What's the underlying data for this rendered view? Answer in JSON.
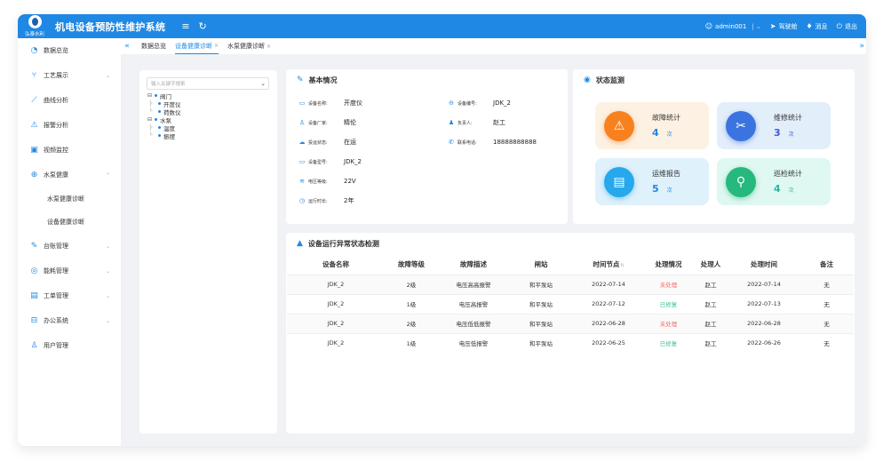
{
  "header": {
    "logo_text": "弘泰水利",
    "title": "机电设备预防性维护系统",
    "menu_icon": "hamburger-icon",
    "refresh_icon": "refresh-icon",
    "user": "admin001",
    "items": [
      {
        "label": "驾驶舱",
        "icon": "send-icon"
      },
      {
        "label": "消息",
        "icon": "bell-icon"
      },
      {
        "label": "退出",
        "icon": "power-icon"
      }
    ]
  },
  "sidebar": {
    "items": [
      {
        "label": "数据总览",
        "icon": "dashboard-icon",
        "has_children": false
      },
      {
        "label": "工艺展示",
        "icon": "process-icon",
        "has_children": true
      },
      {
        "label": "曲线分析",
        "icon": "curve-icon",
        "has_children": false
      },
      {
        "label": "报警分析",
        "icon": "alarm-icon",
        "has_children": false
      },
      {
        "label": "视频监控",
        "icon": "video-icon",
        "has_children": false
      },
      {
        "label": "水泵健康",
        "icon": "health-icon",
        "has_children": true,
        "expanded": true,
        "children": [
          "水泵健康诊断",
          "设备健康诊断"
        ]
      },
      {
        "label": "台账管理",
        "icon": "ledger-icon",
        "has_children": true
      },
      {
        "label": "能耗管理",
        "icon": "energy-icon",
        "has_children": true
      },
      {
        "label": "工单管理",
        "icon": "workorder-icon",
        "has_children": true
      },
      {
        "label": "办公系统",
        "icon": "office-icon",
        "has_children": true
      },
      {
        "label": "用户管理",
        "icon": "user-icon",
        "has_children": false
      }
    ]
  },
  "tabs": [
    {
      "label": "数据总览",
      "closable": false,
      "active": false
    },
    {
      "label": "设备健康诊断",
      "closable": true,
      "active": true
    },
    {
      "label": "水泵健康诊断",
      "closable": true,
      "active": false
    }
  ],
  "tree": {
    "placeholder": "输入关键字搜索",
    "nodes": [
      {
        "label": "阀门",
        "children": [
          "开度仪",
          "荷数仪"
        ]
      },
      {
        "label": "水泵",
        "children": [
          "温度",
          "振摆"
        ]
      }
    ]
  },
  "basic_info": {
    "title": "基本情况",
    "fields": [
      {
        "label": "设备名称:",
        "value": "开度仪",
        "icon": "device-icon"
      },
      {
        "label": "设备编号:",
        "value": "JDK_2",
        "icon": "id-icon"
      },
      {
        "label": "设备厂家:",
        "value": "精伦",
        "icon": "factory-icon"
      },
      {
        "label": "负责人:",
        "value": "赵工",
        "icon": "person-icon"
      },
      {
        "label": "投运状态:",
        "value": "在运",
        "icon": "cloud-icon"
      },
      {
        "label": "联系电话:",
        "value": "18888888888",
        "icon": "phone-icon"
      },
      {
        "label": "设备型号:",
        "value": "JDK_2",
        "icon": "monitor-icon"
      },
      {
        "label": "电压等级:",
        "value": "22V",
        "icon": "voltage-icon"
      },
      {
        "label": "运行时长:",
        "value": "2年",
        "icon": "clock-icon"
      }
    ]
  },
  "status": {
    "title": "状态监测",
    "cards": [
      {
        "name": "故障统计",
        "value": "4",
        "unit": "次",
        "icon": "warning-icon",
        "bg": "#fdf1e3",
        "circle": "#f7811f",
        "color": "#1f88e4"
      },
      {
        "name": "维修统计",
        "value": "3",
        "unit": "次",
        "icon": "tools-icon",
        "bg": "#e3eefb",
        "circle": "#3b73e0",
        "color": "#3b5bd6"
      },
      {
        "name": "运维报告",
        "value": "5",
        "unit": "次",
        "icon": "report-icon",
        "bg": "#dff1fb",
        "circle": "#26a8ec",
        "color": "#1f88e4"
      },
      {
        "name": "巡检统计",
        "value": "4",
        "unit": "次",
        "icon": "location-icon",
        "bg": "#dff8f1",
        "circle": "#26b87c",
        "color": "#26b8a0"
      }
    ]
  },
  "anomaly_table": {
    "title": "设备运行异常状态检测",
    "columns": [
      "设备名称",
      "故障等级",
      "故障描述",
      "闸站",
      "时间节点",
      "处理情况",
      "处理人",
      "处理时间",
      "备注"
    ],
    "rows": [
      [
        "JDK_2",
        "2级",
        "电压高高报警",
        "和平泵站",
        "2022-07-14",
        "未处理",
        "赵工",
        "2022-07-14",
        "无"
      ],
      [
        "JDK_2",
        "1级",
        "电压高报警",
        "和平泵站",
        "2022-07-12",
        "已修复",
        "赵工",
        "2022-07-13",
        "无"
      ],
      [
        "JDK_2",
        "2级",
        "电压低低报警",
        "和平泵站",
        "2022-06-28",
        "未处理",
        "赵工",
        "2022-06-28",
        "无"
      ],
      [
        "JDK_2",
        "1级",
        "电压低报警",
        "和平泵站",
        "2022-06-25",
        "已修复",
        "赵工",
        "2022-06-26",
        "无"
      ]
    ]
  }
}
